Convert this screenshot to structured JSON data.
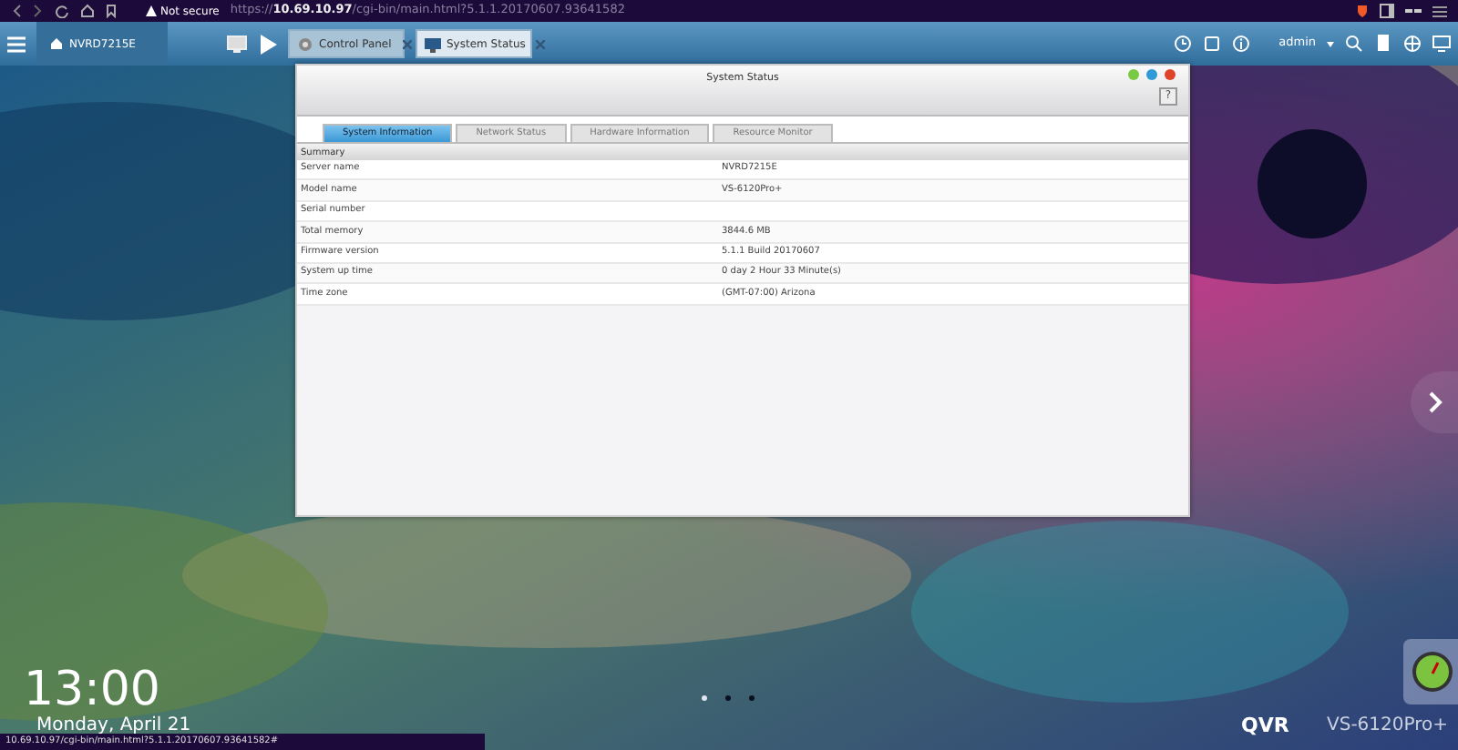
{
  "browser": {
    "security": "Not secure",
    "url": "https://**10.69.10.97**/cgi-bin/main.html?5.1.1.20170607.93641582"
  },
  "toolbar": {
    "home": "NVRD7215E",
    "tabs": [
      {
        "label": "Control Panel",
        "selected": false
      },
      {
        "label": "System Status",
        "selected": true
      }
    ],
    "user": "admin"
  },
  "window": {
    "title": "System Status",
    "help": "?",
    "tabs": [
      {
        "label": "System Information",
        "selected": true
      },
      {
        "label": "Network Status",
        "selected": false
      },
      {
        "label": "Hardware Information",
        "selected": false
      },
      {
        "label": "Resource Monitor",
        "selected": false
      }
    ],
    "section": "Summary",
    "rows": [
      {
        "label": "Server name",
        "value": "NVRD7215E"
      },
      {
        "label": "Model name",
        "value": "VS-6120Pro+"
      },
      {
        "label": "Serial number",
        "value": ""
      },
      {
        "label": "Total memory",
        "value": "3844.6 MB"
      },
      {
        "label": "Firmware version",
        "value": "5.1.1 Build 20170607"
      },
      {
        "label": "System up time",
        "value": "0 day 2 Hour 33 Minute(s)"
      },
      {
        "label": "Time zone",
        "value": "(GMT-07:00) Arizona"
      }
    ]
  },
  "desktop": {
    "clock": "13:00",
    "date": "Monday, April 21",
    "pages": [
      {
        "selected": true
      },
      {
        "selected": false
      },
      {
        "selected": false
      }
    ],
    "brand": "QVR",
    "model": "VS-6120Pro+"
  },
  "status_bar": "10.69.10.97/cgi-bin/main.html?5.1.1.20170607.93641582#"
}
